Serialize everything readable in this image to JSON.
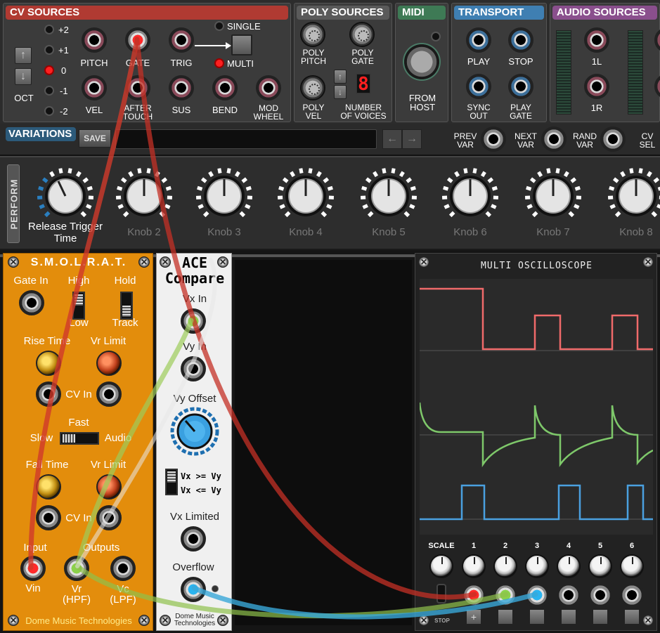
{
  "cv_sources": {
    "title": "CV SOURCES",
    "octave_levels": [
      "+2",
      "+1",
      "0",
      "-1",
      "-2"
    ],
    "octave_selected": "0",
    "oct_label": "OCT",
    "jacks_row1": [
      "PITCH",
      "GATE",
      "TRIG"
    ],
    "jacks_row2": [
      "VEL",
      "AFTER\nTOUCH",
      "SUS",
      "BEND",
      "MOD\nWHEEL"
    ],
    "single_label": "SINGLE",
    "multi_label": "MULTI",
    "mode_selected": "MULTI"
  },
  "poly_sources": {
    "title": "POLY SOURCES",
    "poly_pitch": "POLY\nPITCH",
    "poly_gate": "POLY\nGATE",
    "poly_vel": "POLY\nVEL",
    "voices_label": "NUMBER\nOF VOICES",
    "voices_value": "8"
  },
  "midi": {
    "title": "MIDI",
    "from_host": "FROM\nHOST"
  },
  "transport": {
    "title": "TRANSPORT",
    "jacks": [
      "PLAY",
      "STOP",
      "SYNC\nOUT",
      "PLAY\nGATE"
    ]
  },
  "audio_sources": {
    "title": "AUDIO SOURCES",
    "jacks": [
      "1L",
      "1R"
    ]
  },
  "variations": {
    "title": "VARIATIONS",
    "save_label": "SAVE",
    "field_value": "",
    "jacks": [
      "PREV\nVAR",
      "NEXT\nVAR",
      "RAND\nVAR",
      "CV\nSEL"
    ]
  },
  "perform": {
    "tab_label": "PERFORM",
    "knobs": [
      {
        "label": "Release Trigger\nTime",
        "active": true
      },
      {
        "label": "Knob 2",
        "active": false
      },
      {
        "label": "Knob 3",
        "active": false
      },
      {
        "label": "Knob 4",
        "active": false
      },
      {
        "label": "Knob 5",
        "active": false
      },
      {
        "label": "Knob 6",
        "active": false
      },
      {
        "label": "Knob 7",
        "active": false
      },
      {
        "label": "Knob 8",
        "active": false
      }
    ]
  },
  "smolrat": {
    "title": "S.M.O.L.R.A.T.",
    "gate_in": "Gate In",
    "high": "High",
    "low": "Low",
    "hold": "Hold",
    "track": "Track",
    "rise_time": "Rise Time",
    "vr_limit_1": "Vr Limit",
    "cv_in_1": "CV In",
    "fast": "Fast",
    "slow": "Slow",
    "audio": "Audio",
    "fall_time": "Fall Time",
    "vr_limit_2": "Vr Limit",
    "cv_in_2": "CV In",
    "input": "Input",
    "outputs": "Outputs",
    "vin": "Vin",
    "vr": "Vr\n(HPF)",
    "vc": "Vc\n(LPF)",
    "footer": "Dome Music Technologies"
  },
  "ace": {
    "title": "ACE\nCompare",
    "vx_in": "Vx In",
    "vy_in": "Vy In",
    "vy_offset": "Vy Offset",
    "sw_top": "Vx >= Vy",
    "sw_bot": "Vx <= Vy",
    "vx_limited": "Vx Limited",
    "overflow": "Overflow",
    "footer": "Dome Music\nTechnologies"
  },
  "scope": {
    "title": "MULTI OSCILLOSCOPE",
    "scale_label": "SCALE",
    "channels": [
      "1",
      "2",
      "3",
      "4",
      "5",
      "6"
    ],
    "stop_label": "STOP",
    "trace_colors": [
      "#f06a6a",
      "#7ec86a",
      "#4aa0e0"
    ]
  },
  "colors": {
    "cable_red": "#d0392b",
    "cable_green": "#9ccc5a",
    "cable_blue": "#3aa8d8",
    "smolrat_orange": "#e38d0c"
  }
}
